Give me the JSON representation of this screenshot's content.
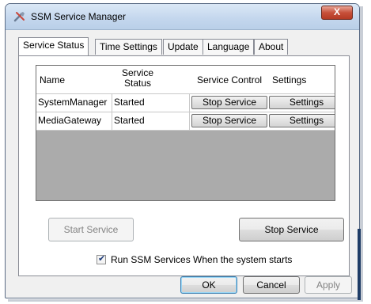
{
  "window": {
    "title": "SSM Service Manager",
    "close_label": "X"
  },
  "tabs": [
    {
      "label": "Service Status",
      "active": true
    },
    {
      "label": "Time Settings",
      "active": false
    },
    {
      "label": "Update",
      "active": false
    },
    {
      "label": "Language",
      "active": false
    },
    {
      "label": "About",
      "active": false
    }
  ],
  "grid": {
    "headers": {
      "name": "Name",
      "status_line1": "Service",
      "status_line2": "Status",
      "control": "Service Control",
      "settings": "Settings"
    },
    "rows": [
      {
        "name": "SystemManager",
        "status": "Started",
        "control_label": "Stop Service",
        "settings_label": "Settings"
      },
      {
        "name": "MediaGateway",
        "status": "Started",
        "control_label": "Stop Service",
        "settings_label": "Settings"
      }
    ]
  },
  "actions": {
    "start_service": "Start Service",
    "stop_service": "Stop Service"
  },
  "run_on_startup": {
    "label": "Run SSM Services When the system starts",
    "checked": true,
    "mark": "✔"
  },
  "footer": {
    "ok": "OK",
    "cancel": "Cancel",
    "apply": "Apply"
  }
}
